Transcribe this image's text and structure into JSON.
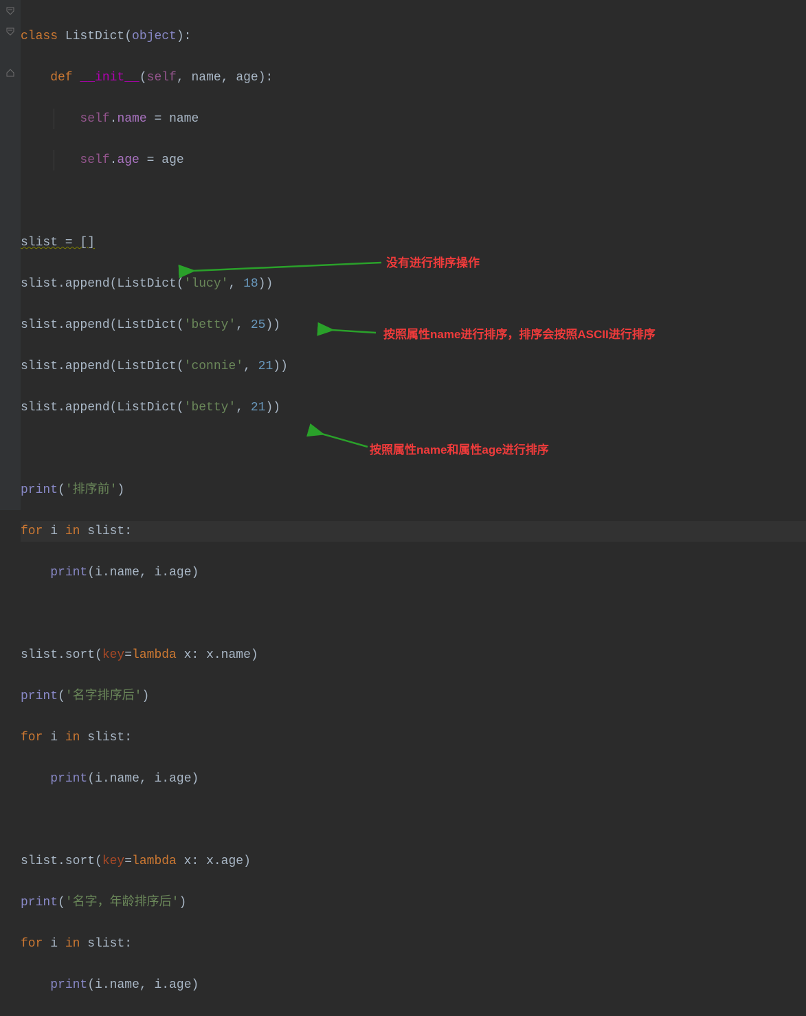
{
  "code": {
    "l1_class": "class ",
    "l1_clsname": "ListDict",
    "l1_open": "(",
    "l1_object": "object",
    "l1_close": "):",
    "l2_def": "    def ",
    "l2_init": "__init__",
    "l2_open": "(",
    "l2_self": "self",
    "l2_comma1": ", ",
    "l2_name": "name",
    "l2_comma2": ", ",
    "l2_age": "age",
    "l2_close": "):",
    "l3_self": "self",
    "l3_dot": ".",
    "l3_attr": "name",
    "l3_eq": " = ",
    "l3_rhs": "name",
    "l4_self": "self",
    "l4_dot": ".",
    "l4_attr": "age",
    "l4_eq": " = ",
    "l4_rhs": "age",
    "l6_slist": "slist = []",
    "append_prefix": "slist.append(ListDict(",
    "append_suffix": "))",
    "s1": "'lucy'",
    "n1": "18",
    "s2": "'betty'",
    "n2": "25",
    "s3": "'connie'",
    "n3": "21",
    "s4": "'betty'",
    "n4": "21",
    "print_open": "(",
    "print_close": ")",
    "print_kw": "print",
    "str_before": "'排序前'",
    "for_kw": "for ",
    "for_var": "i",
    "in_kw": " in ",
    "for_iter": "slist:",
    "loop_i": "i",
    "loop_name": ".name",
    "loop_comma": ", ",
    "loop_age": "i.age",
    "sort_prefix": "slist.sort(",
    "sort_key": "key",
    "sort_eq": "=",
    "lambda_kw": "lambda ",
    "lambda_x": "x: ",
    "lambda_body_name": "x.name",
    "lambda_body_age": "x.age",
    "sort_suffix": ")",
    "str_name_sort": "'名字排序后'",
    "str_age_sort": "'名字，年龄排序后'"
  },
  "annotations": {
    "a1": "没有进行排序操作",
    "a2": "按照属性name进行排序，排序会按照ASCII进行排序",
    "a3": "按照属性name和属性age进行排序"
  }
}
